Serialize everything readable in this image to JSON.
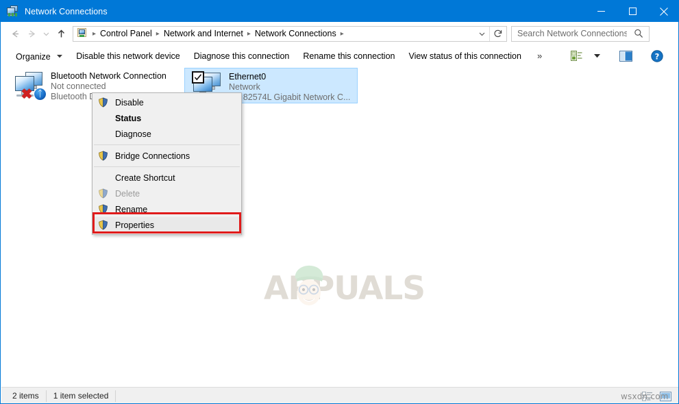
{
  "window": {
    "title": "Network Connections",
    "icon": "network-connections-icon",
    "controls": {
      "minimize": "minimize-button",
      "maximize": "maximize-button",
      "close": "close-button"
    }
  },
  "address_bar": {
    "back": "back-button",
    "forward": "forward-button",
    "recent": "recent-locations-button",
    "up": "up-button",
    "breadcrumbs": [
      {
        "label": "Control Panel"
      },
      {
        "label": "Network and Internet"
      },
      {
        "label": "Network Connections"
      }
    ],
    "dropdown": "previous-locations-chevron",
    "refresh": "refresh-button"
  },
  "search": {
    "placeholder": "Search Network Connections",
    "value": "",
    "icon": "search-icon"
  },
  "command_bar": {
    "items": [
      {
        "label": "Organize",
        "has_caret": true
      },
      {
        "label": "Disable this network device",
        "has_caret": false
      },
      {
        "label": "Diagnose this connection",
        "has_caret": false
      },
      {
        "label": "Rename this connection",
        "has_caret": false
      },
      {
        "label": "View status of this connection",
        "has_caret": false
      }
    ],
    "overflow": "»",
    "view_options_icon": "view-options-icon",
    "view_caret_icon": "chevron-down-icon",
    "preview_pane_icon": "preview-pane-icon",
    "help_icon": "help-icon"
  },
  "connections": [
    {
      "name": "Bluetooth Network Connection",
      "status": "Not connected",
      "device": "Bluetooth D",
      "selected": false,
      "icon": "network-adapter-icon",
      "badges": [
        "red-x-icon",
        "bluetooth-icon"
      ]
    },
    {
      "name": "Ethernet0",
      "status": "Network",
      "device": "(R) 82574L Gigabit Network C...",
      "selected": true,
      "icon": "network-adapter-icon",
      "badges": [
        "checkbox-checked-icon"
      ]
    }
  ],
  "context_menu": {
    "items": [
      {
        "label": "Disable",
        "icon": "shield-icon",
        "bold": false,
        "disabled": false,
        "highlighted": false,
        "separator_after": false
      },
      {
        "label": "Status",
        "icon": "",
        "bold": true,
        "disabled": false,
        "highlighted": false,
        "separator_after": false
      },
      {
        "label": "Diagnose",
        "icon": "",
        "bold": false,
        "disabled": false,
        "highlighted": false,
        "separator_after": true
      },
      {
        "label": "Bridge Connections",
        "icon": "shield-icon",
        "bold": false,
        "disabled": false,
        "highlighted": false,
        "separator_after": true
      },
      {
        "label": "Create Shortcut",
        "icon": "",
        "bold": false,
        "disabled": false,
        "highlighted": false,
        "separator_after": false
      },
      {
        "label": "Delete",
        "icon": "shield-icon",
        "bold": false,
        "disabled": true,
        "highlighted": false,
        "separator_after": false
      },
      {
        "label": "Rename",
        "icon": "shield-icon",
        "bold": false,
        "disabled": false,
        "highlighted": false,
        "separator_after": false
      },
      {
        "label": "Properties",
        "icon": "shield-icon",
        "bold": false,
        "disabled": false,
        "highlighted": true,
        "separator_after": false
      }
    ],
    "highlight_color": "#e01b1b"
  },
  "status_bar": {
    "item_count": "2 items",
    "selection": "1 item selected",
    "details_view_icon": "details-view-icon",
    "large_icons_view_icon": "large-icons-view-icon"
  },
  "watermarks": {
    "brand": "APPUALS",
    "site": "wsxdn.com"
  },
  "colors": {
    "titlebar": "#0078d7",
    "selection": "#cce8ff",
    "highlight_box": "#e01b1b",
    "menu_background": "#f0f0f0"
  }
}
